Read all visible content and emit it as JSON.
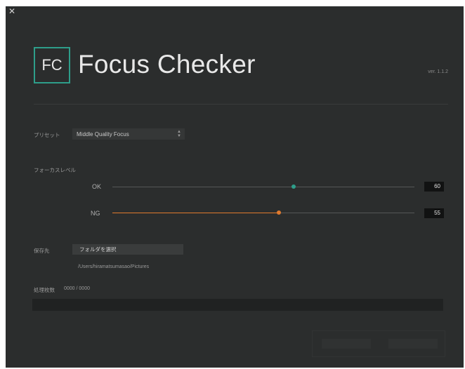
{
  "window": {
    "close_glyph": "✕",
    "close_icon": "close-icon"
  },
  "header": {
    "logo_text": "FC",
    "title": "Focus Checker",
    "version": "ver. 1.1.2",
    "accent_color": "#2e9e8a"
  },
  "preset": {
    "label": "プリセット",
    "selected": "Middle Quality Focus",
    "arrow_up": "▲",
    "arrow_down": "▼"
  },
  "focus_level": {
    "label": "フォーカスレベル",
    "ok": {
      "label": "OK",
      "value": "60",
      "level": 60,
      "color": "#2e9e8a"
    },
    "ng": {
      "label": "NG",
      "value": "55",
      "level": 55,
      "color": "#e07a2e"
    }
  },
  "save": {
    "label": "保存先",
    "button_label": "フォルダを選択",
    "path": "/Users/hiramatsumasao/Pictures"
  },
  "processing": {
    "label": "処理枚数",
    "count": "0000 / 0000",
    "progress": 0
  },
  "actions": {
    "start_label": "",
    "cancel_label": ""
  }
}
